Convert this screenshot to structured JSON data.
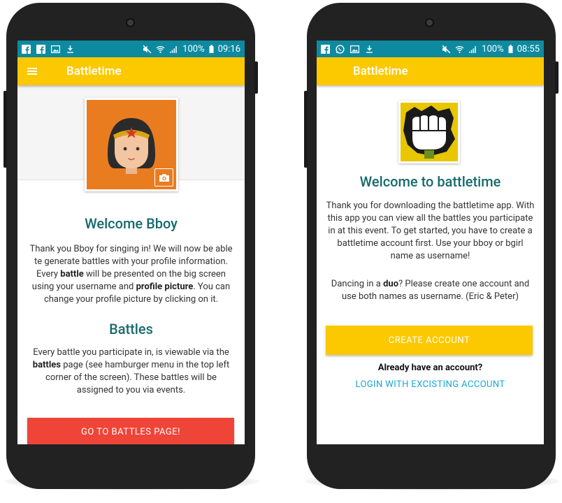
{
  "left_phone": {
    "status": {
      "battery": "100%",
      "time": "09:16"
    },
    "appbar_title": "Battletime",
    "welcome_title": "Welcome Bboy",
    "intro": {
      "p1": "Thank you Bboy for singing in! We will now be able te generate battles with your profile information. Every ",
      "b1": "battle",
      "p2": " will be presented on the big screen using your username and ",
      "b2": "profile picture",
      "p3": ". You can change your profile picture by clicking on it."
    },
    "battles_title": "Battles",
    "battles_text": {
      "p1": "Every battle you participate in, is viewable via the ",
      "b1": "battles",
      "p2": " page (see hamburger menu in the top left corner of the screen). These battles will be assigned to you via events."
    },
    "button_label": "GO TO BATTLES PAGE!"
  },
  "right_phone": {
    "status": {
      "battery": "100%",
      "time": "08:55"
    },
    "appbar_title": "Battletime",
    "welcome_title": "Welcome to battletime",
    "intro": "Thank you for downloading the battletime app. With this app you can view all the battles you participate in at this event. To get started, you have to create a battletime account first. Use your bboy or bgirl name as username!",
    "duo": {
      "p1": "Dancing in a ",
      "b1": "duo",
      "p2": "? Please create one account and use both names as username. (Eric & Peter)"
    },
    "create_label": "CREATE ACCOUNT",
    "already_label": "Already have an account?",
    "login_label": "LOGIN WITH EXCISTING ACCOUNT"
  },
  "colors": {
    "status_bar": "#0e8aa0",
    "app_bar": "#fcc800",
    "heading": "#166a6c",
    "red_button": "#ef4438",
    "link": "#17a7d6"
  }
}
